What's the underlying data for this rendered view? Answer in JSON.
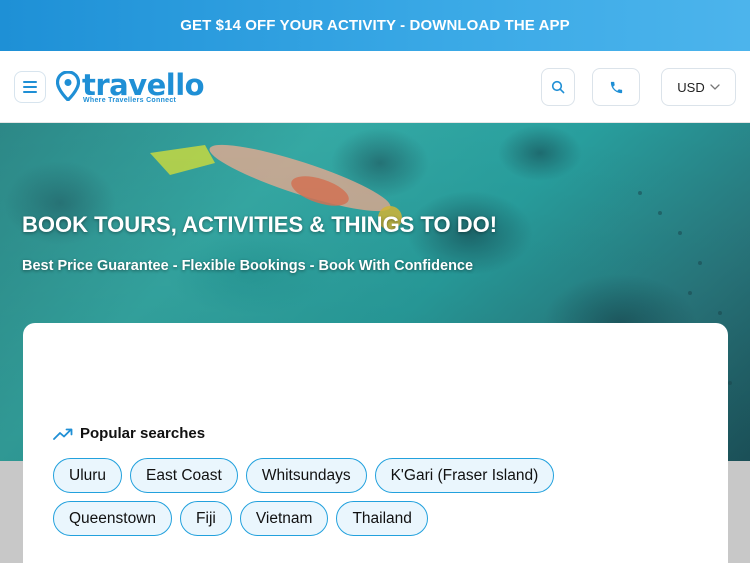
{
  "promo": {
    "text": "GET $14 OFF YOUR ACTIVITY - DOWNLOAD THE APP"
  },
  "header": {
    "logo_text": "travello",
    "logo_tagline": "Where Travellers Connect",
    "currency": "USD"
  },
  "hero": {
    "title": "BOOK TOURS, ACTIVITIES & THINGS TO DO!",
    "subtitle": "Best Price Guarantee - Flexible Bookings - Book With Confidence"
  },
  "popular": {
    "title": "Popular searches",
    "row1": [
      "Uluru",
      "East Coast",
      "Whitsundays",
      "K'Gari (Fraser Island)"
    ],
    "row2": [
      "Queenstown",
      "Fiji",
      "Vietnam",
      "Thailand"
    ]
  },
  "colors": {
    "brand": "#1f8fd5",
    "chip_border": "#22a1dd",
    "chip_bg": "#eaf6fd"
  },
  "icons": [
    "menu-icon",
    "location-pin-icon",
    "search-icon",
    "phone-icon",
    "chevron-down-icon",
    "trending-up-icon"
  ]
}
